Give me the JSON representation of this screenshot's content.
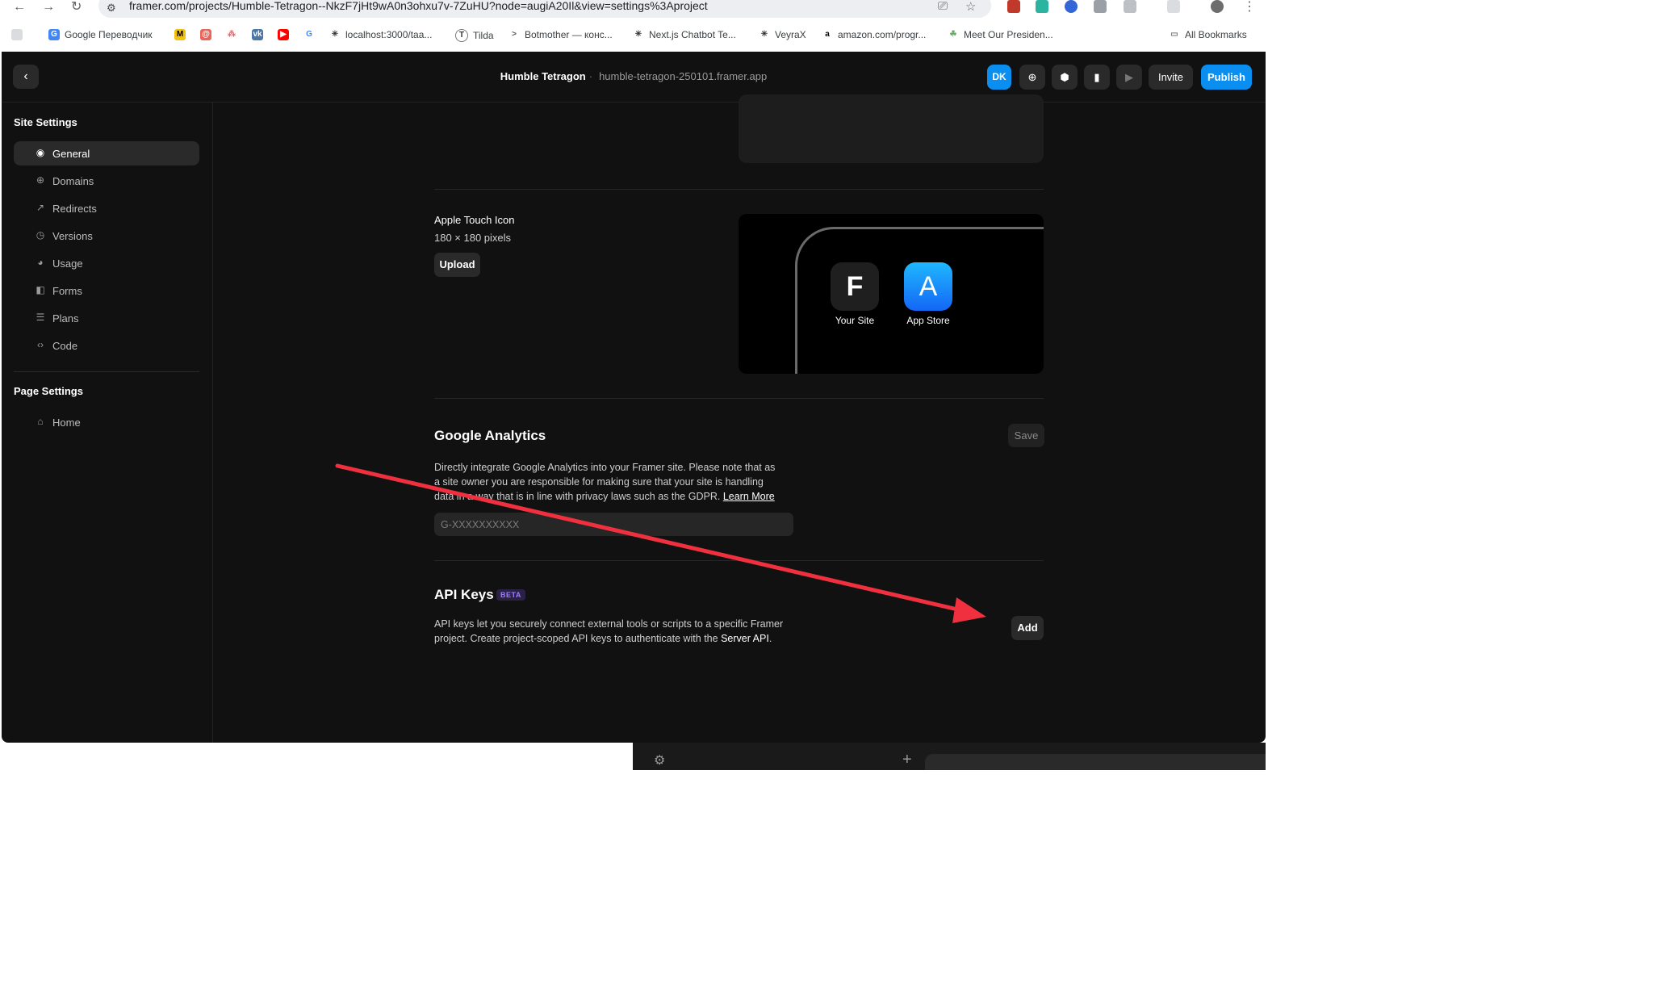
{
  "browser": {
    "url": "framer.com/projects/Humble-Tetragon--NkzF7jHt9wA0n3ohxu7v-7ZuHU?node=augiA20Il&view=settings%3Aproject",
    "bookmarks": [
      "Google Переводчик",
      "localhost:3000/taa...",
      "Tilda",
      "Botmother — конс...",
      "Next.js Chatbot Te...",
      "VeyraX",
      "amazon.com/progr...",
      "Meet Our Presiden..."
    ],
    "all_bookmarks": "All Bookmarks"
  },
  "topbar": {
    "project_name": "Humble Tetragon",
    "project_domain": "humble-tetragon-250101.framer.app",
    "avatar_initials": "DK",
    "invite_label": "Invite",
    "publish_label": "Publish"
  },
  "sidebar": {
    "site_settings_title": "Site Settings",
    "site_items": [
      {
        "label": "General",
        "icon": "gear-icon",
        "active": true
      },
      {
        "label": "Domains",
        "icon": "globe-icon"
      },
      {
        "label": "Redirects",
        "icon": "arrow-up-right-icon"
      },
      {
        "label": "Versions",
        "icon": "clock-icon"
      },
      {
        "label": "Usage",
        "icon": "gauge-icon"
      },
      {
        "label": "Forms",
        "icon": "forms-icon"
      },
      {
        "label": "Plans",
        "icon": "stack-icon"
      },
      {
        "label": "Code",
        "icon": "code-icon"
      }
    ],
    "page_settings_title": "Page Settings",
    "page_items": [
      {
        "label": "Home",
        "icon": "home-icon"
      }
    ]
  },
  "apple_touch_icon": {
    "title": "Apple Touch Icon",
    "size": "180 × 180 pixels",
    "upload_label": "Upload",
    "preview": {
      "your_site_label": "Your Site",
      "app_store_label": "App Store"
    }
  },
  "google_analytics": {
    "title": "Google Analytics",
    "save_label": "Save",
    "description_line1": "Directly integrate Google Analytics into your Framer site. Please note that as",
    "description_line2": "a site owner you are responsible for making sure that your site is handling",
    "description_line3": "data in a way that is in line with privacy laws such as the GDPR.",
    "learn_more": "Learn More",
    "input_placeholder": "G-XXXXXXXXXX",
    "input_value": ""
  },
  "api_keys": {
    "title": "API Keys",
    "badge": "BETA",
    "description_line1": "API keys let you securely connect external tools or scripts to a specific Framer",
    "description_line2": "project. Create project-scoped API keys to authenticate with the",
    "server_api_link": "Server API",
    "period": ".",
    "add_label": "Add"
  },
  "colors": {
    "accent": "#0a8ef0",
    "annotation_arrow": "#f0303f",
    "background": "#111111"
  }
}
